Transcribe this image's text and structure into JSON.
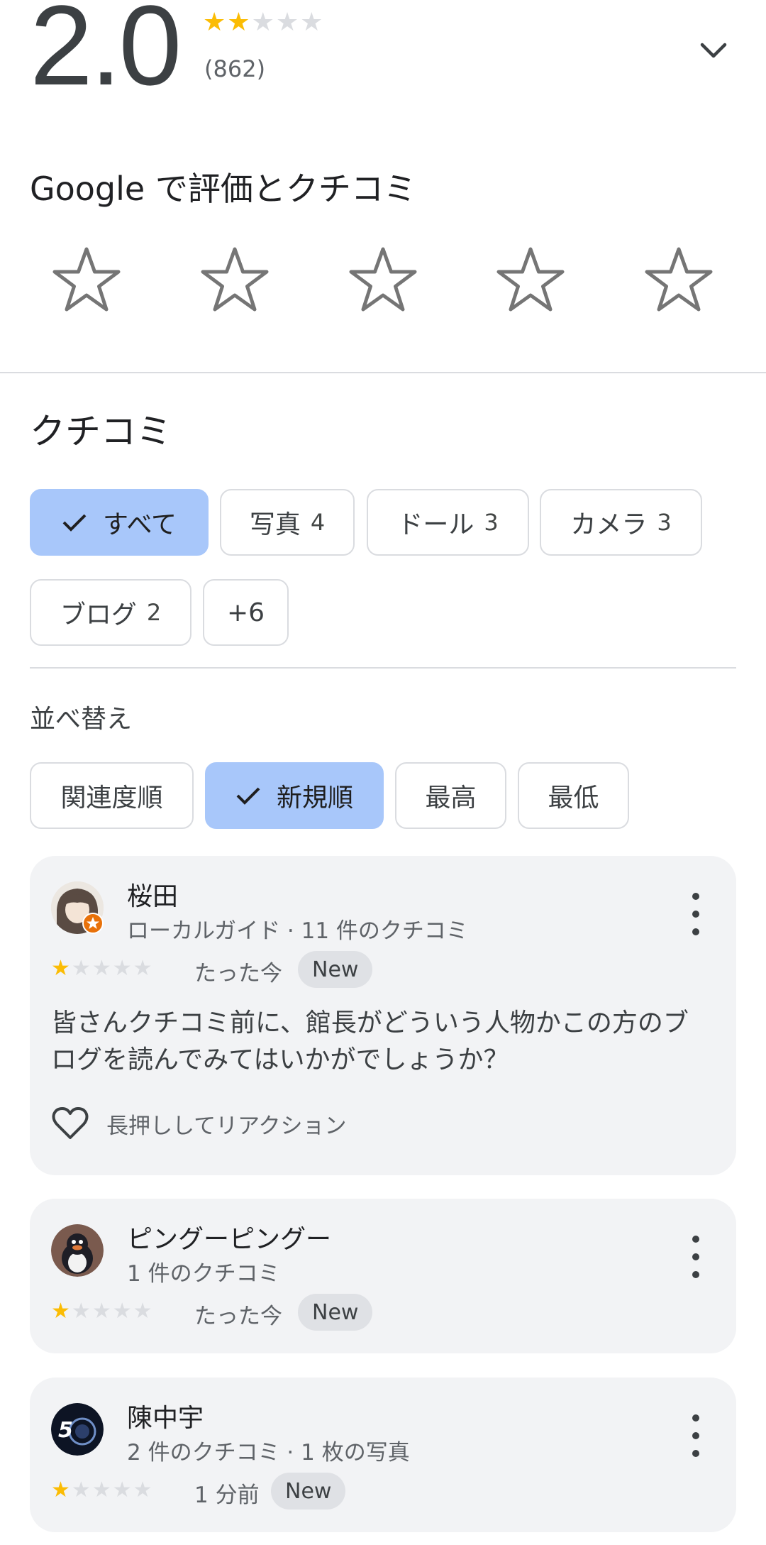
{
  "summary": {
    "rating": "2.0",
    "stars_filled": 2,
    "stars_total": 5,
    "count": "(862)"
  },
  "rate": {
    "title": "Google で評価とクチコミ"
  },
  "reviews_section": {
    "title": "クチコミ",
    "topic_chips": [
      {
        "label": "すべて",
        "count": "",
        "selected": true
      },
      {
        "label": "写真",
        "count": "4",
        "selected": false
      },
      {
        "label": "ドール",
        "count": "3",
        "selected": false
      },
      {
        "label": "カメラ",
        "count": "3",
        "selected": false
      },
      {
        "label": "ブログ",
        "count": "2",
        "selected": false
      },
      {
        "label": "+6",
        "count": "",
        "selected": false
      }
    ],
    "sort_title": "並べ替え",
    "sort_chips": [
      {
        "label": "関連度順",
        "selected": false
      },
      {
        "label": "新規順",
        "selected": true
      },
      {
        "label": "最高",
        "selected": false
      },
      {
        "label": "最低",
        "selected": false
      }
    ]
  },
  "reviews": [
    {
      "name": "桜田",
      "meta": "ローカルガイド · 11 件のクチコミ",
      "rating": 1,
      "time": "たった今",
      "badge": "New",
      "text": "皆さんクチコミ前に、館長がどういう人物かこの方のブログを読んでみてはいかがでしょうか？",
      "reaction_label": "長押ししてリアクション"
    },
    {
      "name": "ピングーピングー",
      "meta": "1 件のクチコミ",
      "rating": 1,
      "time": "たった今",
      "badge": "New"
    },
    {
      "name": "陳中宇",
      "meta": "2 件のクチコミ · 1 枚の写真",
      "rating": 1,
      "time": "1 分前",
      "badge": "New"
    }
  ],
  "colors": {
    "star_filled": "#fbbc04",
    "star_empty": "#dadce0",
    "chip_selected": "#a8c7fa",
    "card_bg": "#f2f3f5"
  }
}
